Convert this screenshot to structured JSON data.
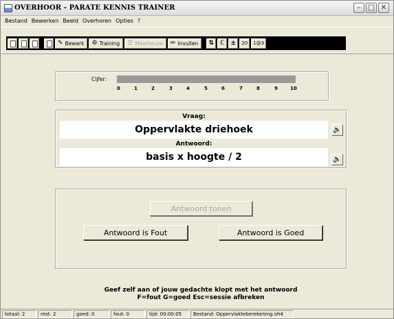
{
  "window": {
    "title": "OVERHOOR - PARATE KENNIS TRAINER",
    "controls": [
      "minimize",
      "maximize",
      "close"
    ]
  },
  "menu": [
    "Bestand",
    "Bewerken",
    "Beeld",
    "Overhoren",
    "Opties",
    "?"
  ],
  "toolbar": {
    "file_icons": [
      "new-file-icon",
      "open-file-icon",
      "save-file-icon",
      "print-icon"
    ],
    "bewerk_label": "Bewerk",
    "training_label": "Training",
    "meerkeuze_label": "Meerkeuze",
    "invullen_label": "Invullen",
    "tools": [
      "swap-icon",
      "font-icon",
      "plus-minus-icon"
    ],
    "count_value": "20",
    "counter_label": "1@3"
  },
  "cijfer": {
    "label": "Cijfer:",
    "ticks": [
      "0",
      "1",
      "2",
      "3",
      "4",
      "5",
      "6",
      "7",
      "8",
      "9",
      "10"
    ],
    "bar_color": "#9a9a9a"
  },
  "question": {
    "label": "Vraag:",
    "text": "Oppervlakte driehoek"
  },
  "answer": {
    "label": "Antwoord:",
    "text": "basis x hoogte / 2"
  },
  "buttons": {
    "show_answer": "Antwoord tonen",
    "wrong": "Antwoord is Fout",
    "right": "Antwoord is Goed"
  },
  "hint": {
    "line1": "Geef zelf aan of jouw gedachte klopt met het antwoord",
    "line2": "F=fout  G=goed  Esc=sessie afbreken"
  },
  "status": {
    "totaal": "totaal: 2",
    "rest": "rest: 2",
    "goed": "goed: 0",
    "fout": "fout: 0",
    "tijd": "tijd: 00:00:05",
    "bestand": "Bestand: Oppervlakteberekening.oh4"
  }
}
